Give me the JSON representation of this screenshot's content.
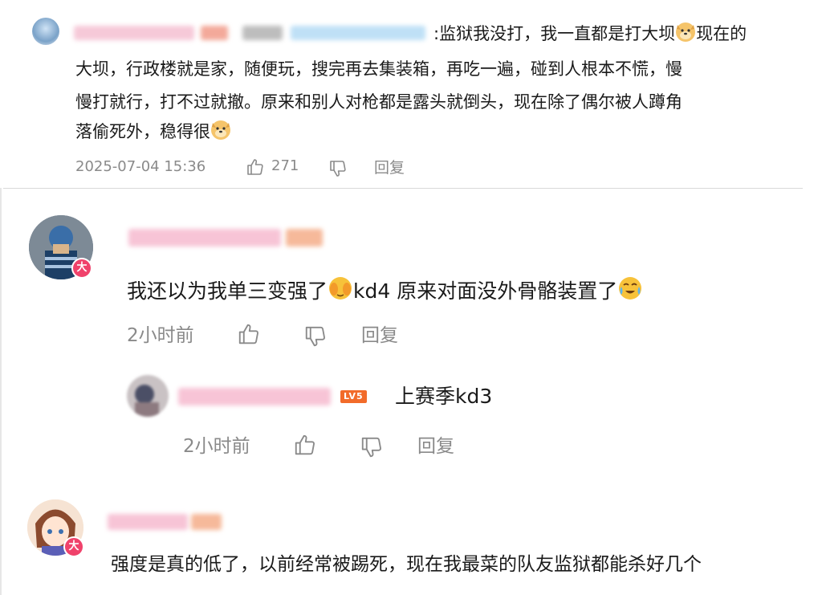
{
  "comment1": {
    "text_line1": ":监狱我没打，我一直都是打大坝",
    "text_line1b": "现在的",
    "text_line2": "大坝，行政楼就是家，随便玩，搜完再去集装箱，再吃一遍，碰到人根本不慌，慢",
    "text_line3": "慢打就行，打不过就撤。原来和别人对枪都是露头就倒头，现在除了偶尔被人蹲角",
    "text_line4": "落偷死外，稳得很",
    "timestamp": "2025-07-04 15:36",
    "like_count": "271",
    "reply_label": "回复"
  },
  "comment2": {
    "badge": "大",
    "text_a": "我还以为我单三变强了",
    "text_b": "kd4 原来对面没外骨骼装置了",
    "time": "2小时前",
    "reply_label": "回复",
    "reply": {
      "level": "LV5",
      "text": "上赛季kd3",
      "time": "2小时前",
      "reply_label": "回复"
    }
  },
  "comment3": {
    "badge": "大",
    "text": "强度是真的低了，以前经常被踢死，现在我最菜的队友监狱都能杀好几个"
  },
  "icons": [
    "thumbs-up-icon",
    "thumbs-down-icon",
    "doge-emoji",
    "facepalm-emoji",
    "crying-laugh-emoji"
  ]
}
